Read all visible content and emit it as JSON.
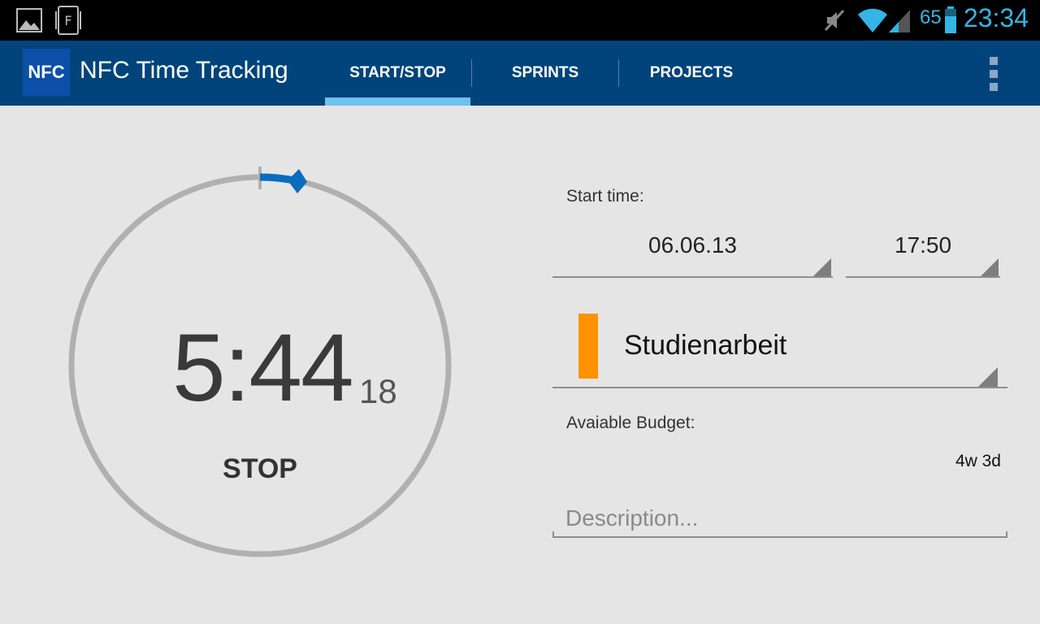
{
  "status_bar": {
    "battery_level": "65",
    "time": "23:34",
    "accent_color": "#33b5e5",
    "icons": [
      "gallery-icon",
      "nfc-file-icon",
      "muted-icon",
      "wifi-icon",
      "signal-icon",
      "battery-icon"
    ]
  },
  "action_bar": {
    "logo_text": "NFC",
    "title": "NFC Time Tracking",
    "background_color": "#01447c",
    "tabs": [
      {
        "label": "START/STOP",
        "selected": true
      },
      {
        "label": "SPRINTS",
        "selected": false
      },
      {
        "label": "PROJECTS",
        "selected": false
      }
    ]
  },
  "timer": {
    "hours_minutes": "5:44",
    "seconds": "18",
    "button_label": "STOP",
    "ring_color": "#b0b0b0",
    "progress_color": "#0a6cbe"
  },
  "form": {
    "start_time_label": "Start time:",
    "start_date": "06.06.13",
    "start_clock": "17:50",
    "project_name": "Studienarbeit",
    "project_color": "#ff9200",
    "budget_label": "Avaiable Budget:",
    "budget_value": "4w 3d",
    "description_placeholder": "Description...",
    "description_value": ""
  }
}
